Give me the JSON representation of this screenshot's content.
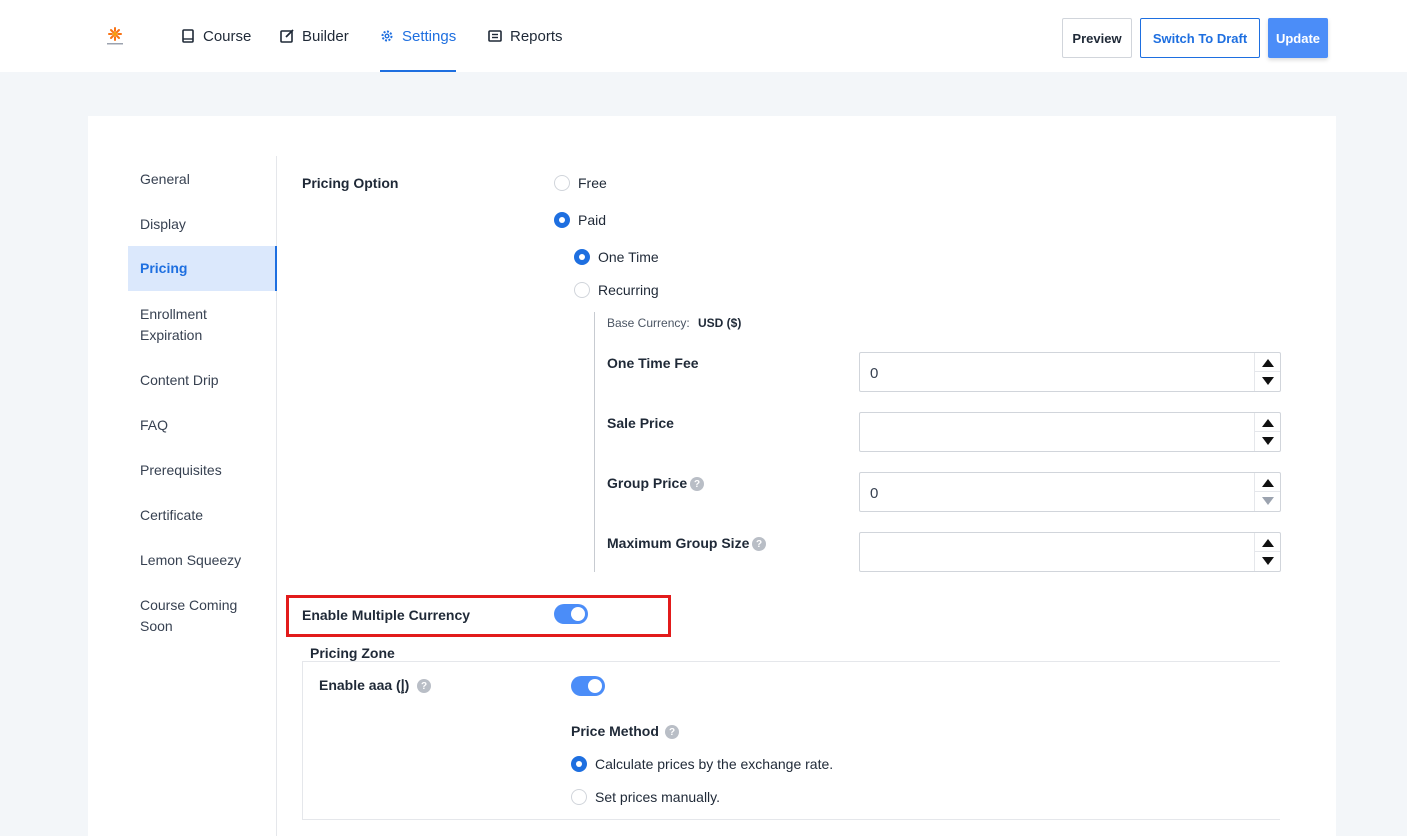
{
  "header": {
    "nav": [
      {
        "label": "Course",
        "icon": "book-icon"
      },
      {
        "label": "Builder",
        "icon": "edit-icon"
      },
      {
        "label": "Settings",
        "icon": "gear-icon"
      },
      {
        "label": "Reports",
        "icon": "report-icon"
      }
    ],
    "active_tab": "Settings",
    "preview_label": "Preview",
    "draft_label": "Switch To Draft",
    "update_label": "Update"
  },
  "sidebar": {
    "items": [
      {
        "label": "General"
      },
      {
        "label": "Display"
      },
      {
        "label": "Pricing"
      },
      {
        "label": "Enrollment Expiration"
      },
      {
        "label": "Content Drip"
      },
      {
        "label": "FAQ"
      },
      {
        "label": "Prerequisites"
      },
      {
        "label": "Certificate"
      },
      {
        "label": "Lemon Squeezy"
      },
      {
        "label": "Course Coming Soon"
      }
    ],
    "active": "Pricing"
  },
  "pricing": {
    "option_label": "Pricing Option",
    "free_label": "Free",
    "paid_label": "Paid",
    "one_time_label": "One Time",
    "recurring_label": "Recurring",
    "base_currency_label": "Base Currency:",
    "base_currency_value": "USD ($)",
    "fields": {
      "one_time_fee": {
        "label": "One Time Fee",
        "value": "0"
      },
      "sale_price": {
        "label": "Sale Price",
        "value": ""
      },
      "group_price": {
        "label": "Group Price",
        "value": "0"
      },
      "max_group_size": {
        "label": "Maximum Group Size",
        "value": ""
      }
    },
    "multi_currency_label": "Enable Multiple Currency",
    "zone_title": "Pricing Zone",
    "enable_zone_label": "Enable aaa (إ)",
    "price_method_label": "Price Method",
    "method_exchange_label": "Calculate prices by the exchange rate.",
    "method_manual_label": "Set prices manually."
  },
  "colors": {
    "accent": "#1e6fe0",
    "toggle": "#4b8df8",
    "highlight": "#e21b1b"
  }
}
